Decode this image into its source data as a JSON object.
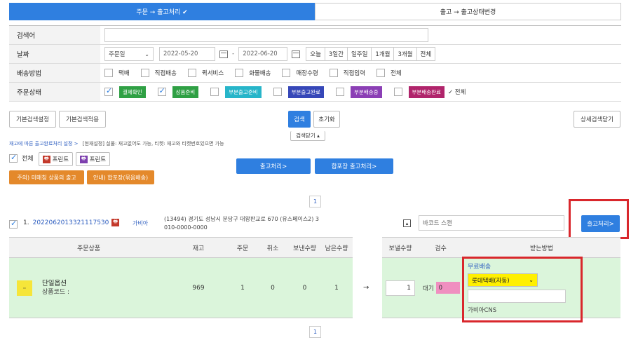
{
  "tabs": {
    "active": "주문 → 출고처리 ✔",
    "inactive": "출고 → 출고상태변경"
  },
  "form": {
    "search_label": "검색어",
    "date_label": "날짜",
    "date_type": "주문일",
    "date_from": "2022-05-20",
    "date_sep": "-",
    "date_to": "2022-06-20",
    "periods": [
      "오늘",
      "3일간",
      "일주일",
      "1개월",
      "3개월",
      "전체"
    ],
    "ship_label": "배송방법",
    "ship_options": [
      "택배",
      "직접배송",
      "퀵서비스",
      "화물배송",
      "매장수령",
      "직접입력",
      "전체"
    ],
    "status_label": "주문상태",
    "status_options": [
      {
        "label": "결제확인",
        "color": "#2fa044",
        "checked": true
      },
      {
        "label": "상품준비",
        "color": "#2fa044",
        "checked": true
      },
      {
        "label": "부분출고준비",
        "color": "#27b5c9",
        "checked": false
      },
      {
        "label": "부분출고완료",
        "color": "#3647b8",
        "checked": false
      },
      {
        "label": "부분배송중",
        "color": "#8b3fb5",
        "checked": false
      },
      {
        "label": "부분배송완료",
        "color": "#b0246b",
        "checked": false
      }
    ],
    "status_all": "✓ 전체"
  },
  "buttons": {
    "basic_setting": "기본검색설정",
    "basic_apply": "기본검색적용",
    "search": "검색",
    "reset": "초기화",
    "detail_close": "상세검색닫기",
    "search_close": "검색닫기 ▴",
    "print1": "프린트",
    "print2": "프린트",
    "process": "출고처리>",
    "combined_process": "합포장 출고처리>",
    "warn1": "주의) 미매칭 상품의 출고",
    "warn2": "안내) 합포장(묶음배송)",
    "row_process": "출고처리>"
  },
  "info": {
    "link": "재고에 따른 출고완료처리 설정 >",
    "note": "[현재설정] 실물: 재고없어도 가능,  티켓: 재고와 티켓번호있으면 가능",
    "select_all": "전체"
  },
  "pager": "1",
  "order": {
    "index": "1.",
    "number": "2022062013321117530",
    "buyer": "가비아",
    "address": "(13494) 경기도 성남시 분당구 대왕판교로 670 (유스페이스2) 3",
    "phone": "010-0000-0000",
    "barcode_placeholder": "바코드 스캔"
  },
  "table": {
    "headers": [
      "주문상품",
      "재고",
      "주문",
      "취소",
      "보낸수량",
      "남은수량",
      "보낼수량",
      "검수",
      "받는방법"
    ],
    "row": {
      "product_name": "단일옵션",
      "product_code": "상품코드 :",
      "stock": "969",
      "ordered": "1",
      "cancelled": "0",
      "sent": "0",
      "remaining": "1",
      "arrow": "→",
      "to_send": "1",
      "inspect_label": "대기",
      "inspect_value": "0",
      "ship_type": "무료배송",
      "courier": "롯데택배(자동)",
      "carrier_name": "가비아CNS"
    }
  }
}
